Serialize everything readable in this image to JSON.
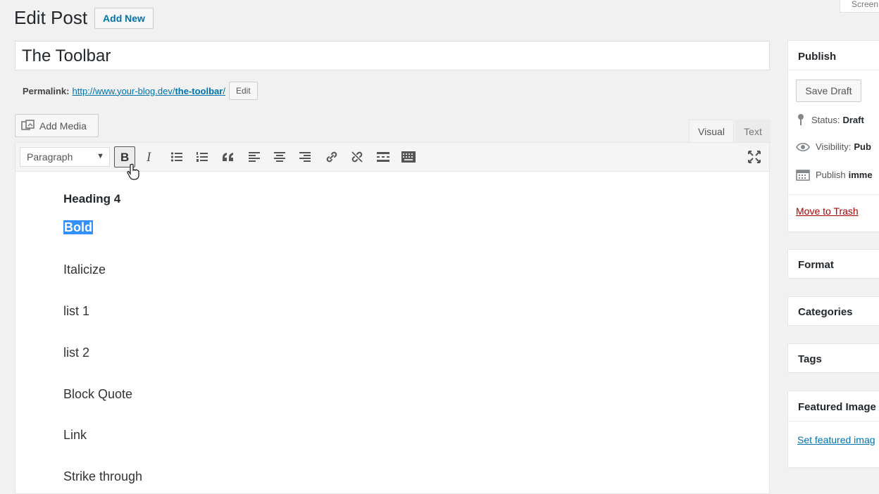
{
  "header": {
    "title": "Edit Post",
    "add_new_label": "Add New",
    "screen_options_label": "Screen"
  },
  "post": {
    "title": "The Toolbar",
    "permalink_label": "Permalink:",
    "permalink_base": "http://www.your-blog.dev/",
    "permalink_slug": "the-toolbar",
    "permalink_trailing": "/",
    "edit_slug_label": "Edit"
  },
  "editor": {
    "add_media_label": "Add Media",
    "tabs": [
      {
        "label": "Visual",
        "active": true
      },
      {
        "label": "Text",
        "active": false
      }
    ],
    "format_select_value": "Paragraph",
    "toolbar_icons": [
      "bold-icon",
      "italic-icon",
      "bullet-list-icon",
      "numbered-list-icon",
      "blockquote-icon",
      "align-left-icon",
      "align-center-icon",
      "align-right-icon",
      "link-icon",
      "unlink-icon",
      "read-more-icon",
      "toolbar-toggle-icon",
      "fullscreen-icon"
    ],
    "content": [
      {
        "text": "Heading 4",
        "style": "heading"
      },
      {
        "text": "Bold",
        "style": "selected"
      },
      {
        "text": "Italicize",
        "style": "paragraph"
      },
      {
        "text": "list 1",
        "style": "paragraph"
      },
      {
        "text": "list 2",
        "style": "paragraph"
      },
      {
        "text": "Block Quote",
        "style": "paragraph"
      },
      {
        "text": "Link",
        "style": "paragraph"
      },
      {
        "text": "Strike through",
        "style": "paragraph"
      }
    ]
  },
  "sidebar": {
    "publish": {
      "title": "Publish",
      "save_draft_label": "Save Draft",
      "status_label": "Status:",
      "status_value": "Draft",
      "visibility_label": "Visibility:",
      "visibility_value": "Pub",
      "publish_label": "Publish",
      "publish_value": "imme",
      "trash_label": "Move to Trash"
    },
    "format_title": "Format",
    "categories_title": "Categories",
    "tags_title": "Tags",
    "featured_image_title": "Featured Image",
    "set_featured_label": "Set featured imag"
  },
  "colors": {
    "link": "#0073aa",
    "selection": "#3390ff",
    "trash": "#a00000"
  }
}
